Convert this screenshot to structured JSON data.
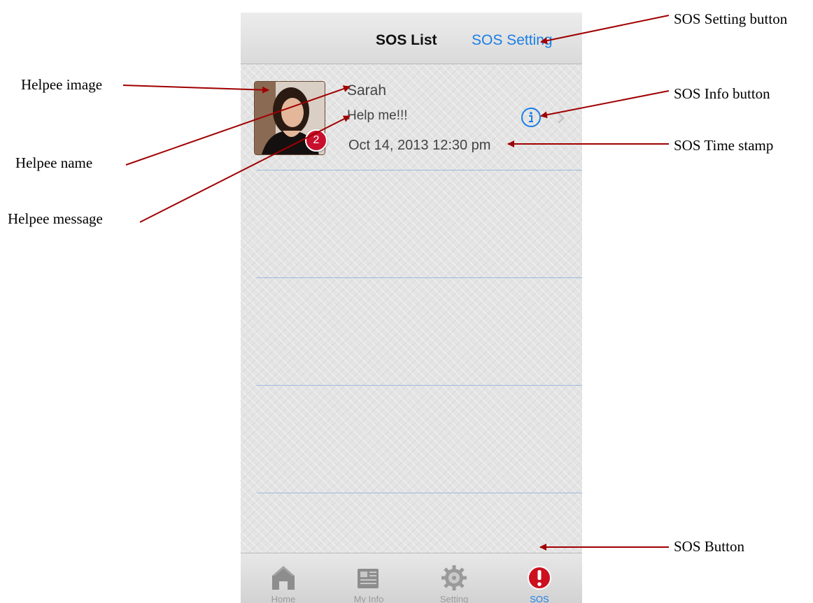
{
  "navbar": {
    "title": "SOS List",
    "setting_button": "SOS Setting"
  },
  "sos_list": [
    {
      "badge": "2",
      "name": "Sarah",
      "message": "Help me!!!",
      "timestamp": "Oct 14, 2013  12:30 pm",
      "info_icon": "info-circle-icon",
      "chevron_icon": "chevron-right-icon"
    }
  ],
  "tabbar": {
    "tabs": [
      {
        "label": "Home",
        "icon": "home-icon",
        "active": false
      },
      {
        "label": "My Info",
        "icon": "newspaper-icon",
        "active": false
      },
      {
        "label": "Setting",
        "icon": "gear-icon",
        "active": false
      },
      {
        "label": "SOS",
        "icon": "alert-icon",
        "active": true
      }
    ]
  },
  "annotations": {
    "helpee_image": "Helpee image",
    "helpee_name": "Helpee name",
    "helpee_message": "Helpee message",
    "sos_setting_button": "SOS Setting button",
    "sos_info_button": "SOS Info button",
    "sos_time_stamp": "SOS Time stamp",
    "sos_button": "SOS Button"
  },
  "colors": {
    "accent_blue": "#1a7ee6",
    "badge_red": "#c8102e",
    "annotation_arrow": "#a00000",
    "separator": "#9fb8dc"
  }
}
